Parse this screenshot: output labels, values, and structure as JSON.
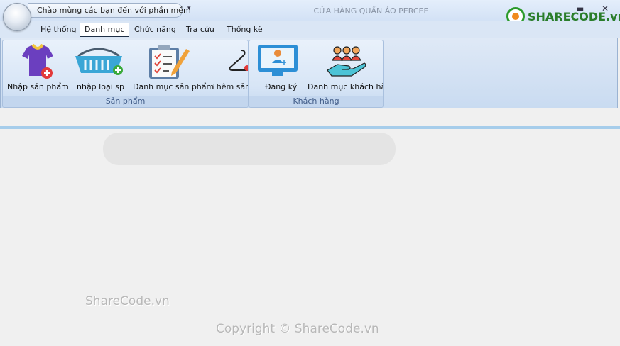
{
  "qat": {
    "greeting": "Chào mừng các bạn đến với phần mềm",
    "dropdown": "▾"
  },
  "app_title": "CỬA HÀNG QUẦN ÁO PERCEE",
  "window": {
    "minimize": "▬",
    "close": "✕"
  },
  "brand": {
    "text": "SHARECODE.vn"
  },
  "tabs": [
    {
      "label": "Hệ thống",
      "active": false
    },
    {
      "label": "Danh mục",
      "active": true
    },
    {
      "label": "Chức năng",
      "active": false
    },
    {
      "label": "Tra cứu",
      "active": false
    },
    {
      "label": "Thống kê",
      "active": false
    }
  ],
  "groups": [
    {
      "caption": "Sản phẩm",
      "buttons": [
        {
          "label": "Nhập sản phẩm",
          "icon": "tshirt-add-icon"
        },
        {
          "label": "nhập loại sp",
          "icon": "basket-add-icon"
        },
        {
          "label": "Danh mục sản phẩm",
          "icon": "clipboard-pencil-icon"
        },
        {
          "label": "Thêm sản phẩm",
          "icon": "hanger-icon"
        }
      ]
    },
    {
      "caption": "Khách hàng",
      "buttons": [
        {
          "label": "Đăng ký",
          "icon": "register-monitor-icon"
        },
        {
          "label": "Danh mục khách hàng",
          "icon": "customers-hand-icon"
        }
      ]
    }
  ],
  "watermarks": {
    "top": "ShareCode.vn",
    "bottom": "Copyright © ShareCode.vn"
  },
  "colors": {
    "ribbon": "#d7e5f6",
    "brand_green": "#2a7d2a",
    "brand_orange": "#f08a1c",
    "caption_text": "#3f5a86"
  }
}
